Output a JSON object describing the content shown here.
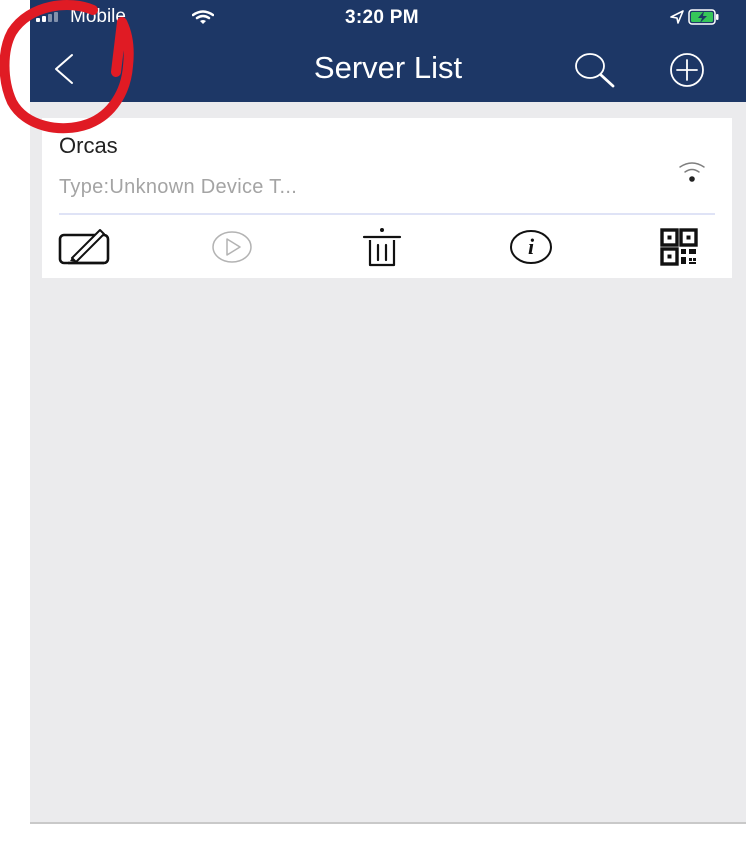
{
  "status_bar": {
    "carrier": "Mobile",
    "time": "3:20 PM"
  },
  "nav": {
    "title": "Server List"
  },
  "devices": [
    {
      "name": "Orcas",
      "type": "Type:Unknown Device T..."
    }
  ],
  "icons": {
    "back": "back-chevron-icon",
    "search": "search-icon",
    "add": "add-circle-icon",
    "online": "wifi-icon",
    "edit": "edit-icon",
    "play": "play-icon",
    "delete": "trash-icon",
    "info": "info-icon",
    "qr": "qr-code-icon"
  },
  "colors": {
    "header_background": "#1d3766",
    "page_background": "#ebebed",
    "card_background": "#ffffff",
    "annotation_red": "#e01b24"
  }
}
